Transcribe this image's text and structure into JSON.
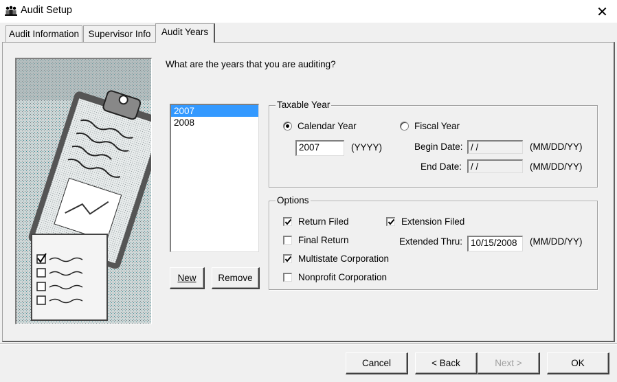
{
  "window": {
    "title": "Audit Setup",
    "close_glyph": "✕",
    "app_icon": "people-icon"
  },
  "tabs": [
    {
      "label": "Audit Information",
      "active": false
    },
    {
      "label": "Supervisor Info",
      "active": false
    },
    {
      "label": "Audit Years",
      "active": true
    }
  ],
  "main": {
    "question": "What are the years that you are auditing?",
    "years": [
      "2007",
      "2008"
    ],
    "selected_year": "2007",
    "new_button": "New",
    "remove_button": "Remove"
  },
  "taxable_year": {
    "label": "Taxable Year",
    "calendar_label": "Calendar Year",
    "calendar_selected": true,
    "fiscal_label": "Fiscal Year",
    "fiscal_selected": false,
    "year_value": "2007",
    "year_hint": "(YYYY)",
    "begin_label": "Begin Date:",
    "begin_value": "/ /",
    "end_label": "End Date:",
    "end_value": "/ /",
    "date_hint": "(MM/DD/YY)"
  },
  "options": {
    "label": "Options",
    "return_filed": {
      "label": "Return Filed",
      "checked": true
    },
    "final_return": {
      "label": "Final Return",
      "checked": false
    },
    "multistate": {
      "label": "Multistate Corporation",
      "checked": true
    },
    "nonprofit": {
      "label": "Nonprofit Corporation",
      "checked": false
    },
    "extension_filed": {
      "label": "Extension Filed",
      "checked": true
    },
    "extended_thru_label": "Extended Thru:",
    "extended_thru_value": "10/15/2008",
    "date_hint": "(MM/DD/YY)"
  },
  "footer": {
    "cancel": "Cancel",
    "back": "< Back",
    "next": "Next >",
    "ok": "OK"
  },
  "colors": {
    "selection": "#3399ff",
    "face": "#f0f0f0"
  }
}
